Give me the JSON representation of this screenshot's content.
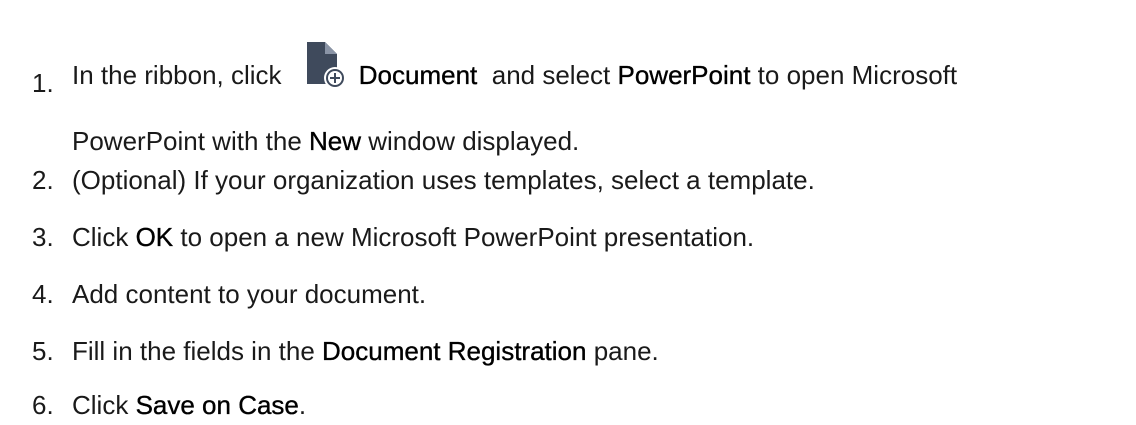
{
  "steps": [
    {
      "num": "1.",
      "parts": {
        "a": "In the ribbon, click ",
        "b1": "Document",
        "c": "  and select ",
        "b2": "PowerPoint",
        "d": " to open Microsoft",
        "e": "PowerPoint with the ",
        "b3": "New",
        "f": " window displayed."
      },
      "icon": "document-add-icon"
    },
    {
      "num": "2.",
      "text": "(Optional) If your organization uses templates, select a template."
    },
    {
      "num": "3.",
      "a": "Click ",
      "b": "OK",
      "c": " to open a new Microsoft PowerPoint presentation."
    },
    {
      "num": "4.",
      "text": "Add content to your document."
    },
    {
      "num": "5.",
      "a": "Fill in the fields in the ",
      "b": "Document Registration",
      "c": " pane."
    },
    {
      "num": "6.",
      "a": "Click ",
      "b": "Save on Case",
      "c": "."
    }
  ]
}
